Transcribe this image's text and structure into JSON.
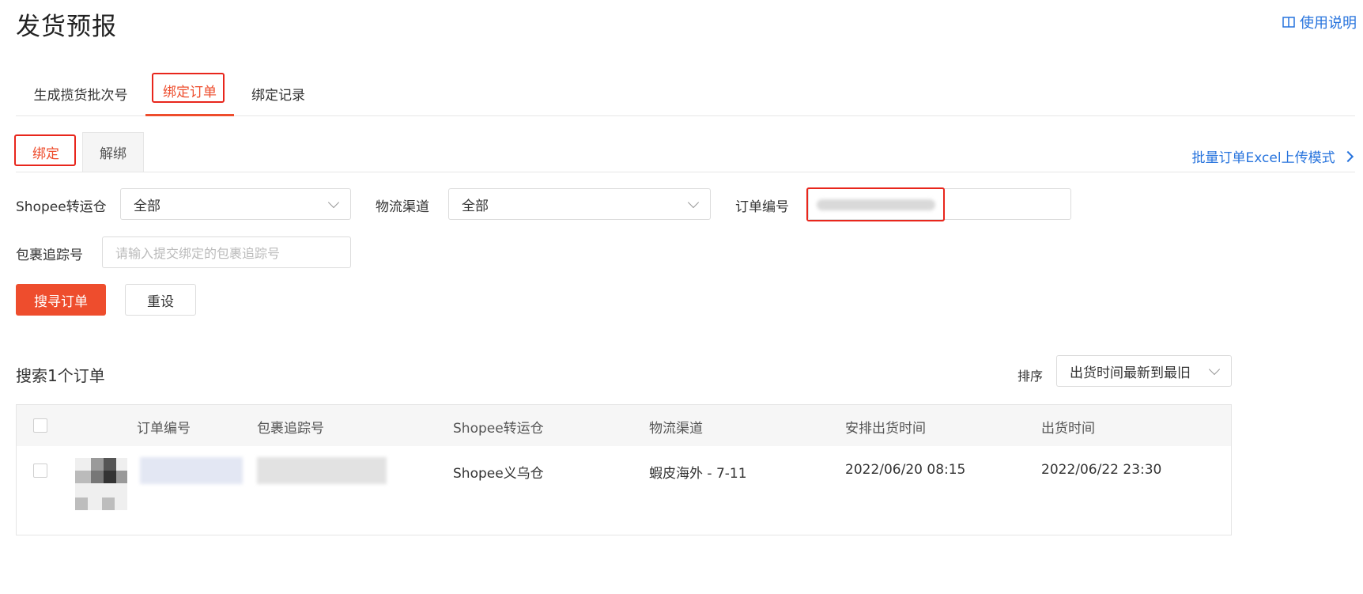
{
  "page": {
    "title": "发货预报",
    "help_link": "使用说明"
  },
  "tabs": [
    {
      "label": "生成揽货批次号"
    },
    {
      "label": "绑定订单"
    },
    {
      "label": "绑定记录"
    }
  ],
  "subtabs": [
    {
      "label": "绑定"
    },
    {
      "label": "解绑"
    }
  ],
  "batch_link": "批量订单Excel上传模式",
  "filters": {
    "warehouse": {
      "label": "Shopee转运仓",
      "value": "全部"
    },
    "channel": {
      "label": "物流渠道",
      "value": "全部"
    },
    "order_no": {
      "label": "订单编号"
    },
    "tracking": {
      "label": "包裹追踪号",
      "placeholder": "请输入提交绑定的包裹追踪号"
    }
  },
  "buttons": {
    "search": "搜寻订单",
    "reset": "重设"
  },
  "results": {
    "count_text": "搜索1个订单",
    "sort_label": "排序",
    "sort_value": "出货时间最新到最旧"
  },
  "table": {
    "columns": [
      "订单编号",
      "包裹追踪号",
      "Shopee转运仓",
      "物流渠道",
      "安排出货时间",
      "出货时间"
    ],
    "rows": [
      {
        "warehouse": "Shopee义乌仓",
        "channel": "蝦皮海外 - 7-11",
        "scheduled_time": "2022/06/20 08:15",
        "ship_time": "2022/06/22 23:30"
      }
    ]
  },
  "colors": {
    "accent": "#ee4d2d",
    "link": "#2673dd",
    "highlight_box": "#e8261c"
  },
  "icons": [
    "book-icon",
    "chevron-right-icon",
    "chevron-down-icon"
  ]
}
